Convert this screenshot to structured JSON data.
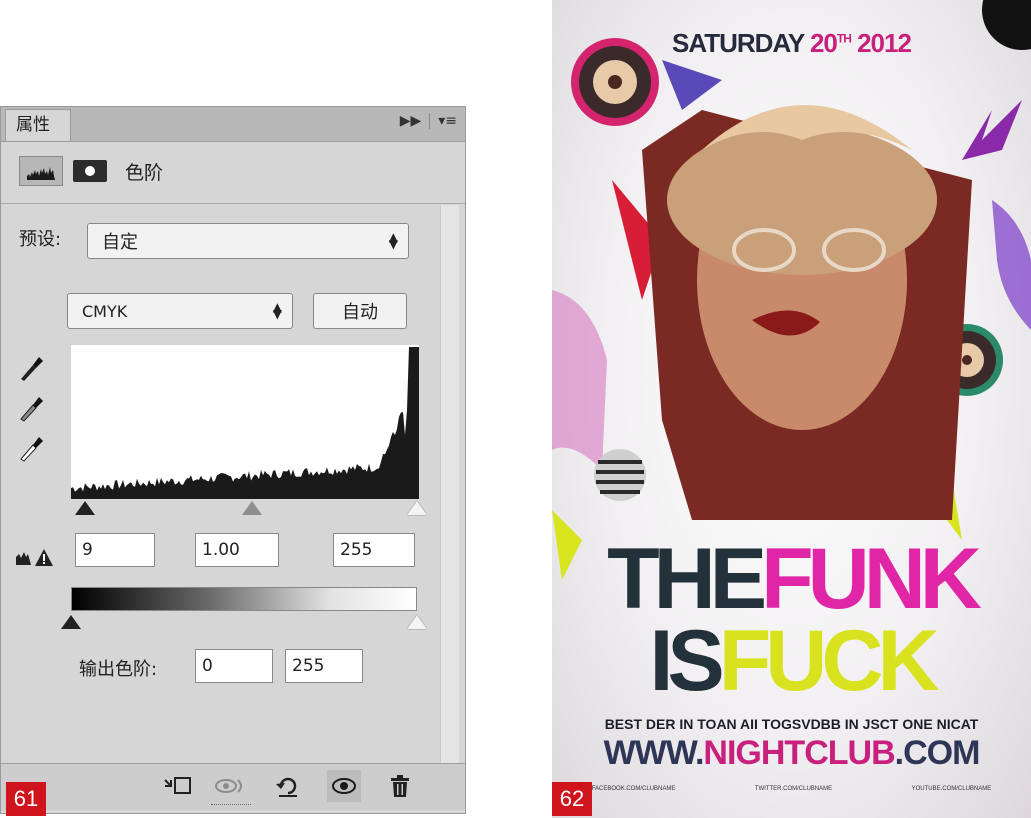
{
  "panel": {
    "tab_label": "属性",
    "title": "色阶",
    "preset_label": "预设:",
    "preset_value": "自定",
    "channel_value": "CMYK",
    "auto_label": "自动",
    "input_black": "9",
    "input_gamma": "1.00",
    "input_white": "255",
    "output_label": "输出色阶:",
    "output_black": "0",
    "output_white": "255",
    "icons": [
      "levels-mode-icon",
      "mask-icon",
      "black-point-eyedropper-icon",
      "gray-point-eyedropper-icon",
      "white-point-eyedropper-icon",
      "clip-to-layer-icon",
      "view-previous-icon",
      "reset-icon",
      "visibility-icon",
      "delete-icon",
      "panel-menu-icon",
      "collapse-icon"
    ]
  },
  "badges": {
    "left": "61",
    "right": "62"
  },
  "poster": {
    "date_prefix": "SATURDAY ",
    "date_day": "20",
    "date_sup": "TH",
    "date_year": " 2012",
    "title_the": "THE",
    "title_funk": "FUNK",
    "title_is": "IS",
    "title_fuck": "FUCK",
    "tagline": "BEST DER IN TOAN AII TOGSVDBB IN JSCT ONE NICAT",
    "url_www": "WWW.",
    "url_name": "NIGHTCLUB",
    "url_com": ".COM",
    "social_1": "FACEBOOK.COM/CLUBNAME",
    "social_2": "TWITTER.COM/CLUBNAME",
    "social_3": "YOUTUBE.COM/CLUBNAME"
  }
}
